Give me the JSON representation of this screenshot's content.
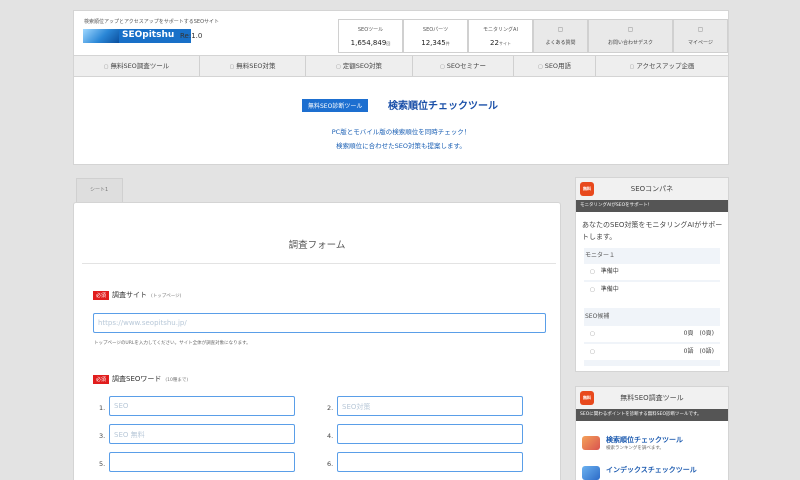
{
  "header": {
    "tagline": "検索順位アップとアクセスアップをサポートするSEOサイト",
    "logo_text": "SEOpitshu",
    "version": "Re:1.0",
    "stats": [
      {
        "label": "SEOツール",
        "value": "1,654,849",
        "unit": "回"
      },
      {
        "label": "SEOパーツ",
        "value": "12,345",
        "unit": "件"
      },
      {
        "label": "モニタリングAI",
        "value": "22",
        "unit": "サイト"
      }
    ],
    "icon_buttons": [
      {
        "icon": "faq-icon",
        "glyph": "▢",
        "label": "よくある質問"
      },
      {
        "icon": "contact-icon",
        "glyph": "▢",
        "label": "お問い合わせデスク"
      },
      {
        "icon": "mypage-icon",
        "glyph": "▢",
        "label": "マイページ"
      }
    ]
  },
  "nav": {
    "items": [
      {
        "label": "無料SEO調査ツール"
      },
      {
        "label": "無料SEO対策"
      },
      {
        "label": "定額SEO対策"
      },
      {
        "label": "SEOセミナー"
      },
      {
        "label": "SEO用語"
      },
      {
        "label": "アクセスアップ企画"
      }
    ]
  },
  "hero": {
    "badge": "無料SEO診断ツール",
    "title": "検索順位チェックツール",
    "line1": "PC版とモバイル版の検索順位を同時チェック！",
    "line2": "検索順位に合わせたSEO対策も提案します。"
  },
  "tab": {
    "label": "シート1"
  },
  "form": {
    "title": "調査フォーム",
    "required_label": "必須",
    "site_label": "調査サイト",
    "site_note": "(トップページ)",
    "url_placeholder": "https://www.seopitshu.jp/",
    "url_hint": "トップページのURLを入力してください。サイト全体が調査対象になります。",
    "keywords_label": "調査SEOワード",
    "keywords_note": "(10種まで)",
    "keywords": [
      {
        "num": "1.",
        "placeholder": "SEO"
      },
      {
        "num": "2.",
        "placeholder": "SEO対策"
      },
      {
        "num": "3.",
        "placeholder": "SEO 無料"
      },
      {
        "num": "4.",
        "placeholder": ""
      },
      {
        "num": "5.",
        "placeholder": ""
      },
      {
        "num": "6.",
        "placeholder": ""
      }
    ]
  },
  "sidebar": {
    "compane": {
      "badge": "無料",
      "title": "SEOコンパネ",
      "subtitle": "モニタリングAIがSEOをサポート!",
      "text": "あなたのSEO対策をモニタリングAIがサポートします。",
      "monitor_label": "モニター１",
      "monitor_rows": [
        "準備中",
        "準備中"
      ],
      "seo_label": "SEO候補",
      "seo_rows": [
        "0頁　(0頁)",
        "0語　(0語)"
      ]
    },
    "tools": {
      "badge": "無料",
      "title": "無料SEO調査ツール",
      "subtitle": "SEOに関わるポイントを診断する無料SEO診断ツールです。",
      "items": [
        {
          "name": "検索順位チェックツール",
          "desc": "検索ランキングを調べます。"
        },
        {
          "name": "インデックスチェックツール",
          "desc": ""
        }
      ]
    }
  }
}
